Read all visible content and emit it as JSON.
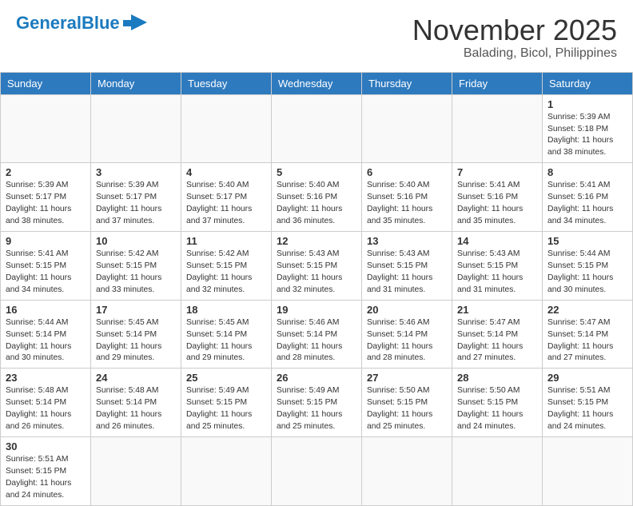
{
  "header": {
    "logo_general": "General",
    "logo_blue": "Blue",
    "month_title": "November 2025",
    "location": "Balading, Bicol, Philippines"
  },
  "weekdays": [
    "Sunday",
    "Monday",
    "Tuesday",
    "Wednesday",
    "Thursday",
    "Friday",
    "Saturday"
  ],
  "weeks": [
    [
      {
        "day": "",
        "text": ""
      },
      {
        "day": "",
        "text": ""
      },
      {
        "day": "",
        "text": ""
      },
      {
        "day": "",
        "text": ""
      },
      {
        "day": "",
        "text": ""
      },
      {
        "day": "",
        "text": ""
      },
      {
        "day": "1",
        "text": "Sunrise: 5:39 AM\nSunset: 5:18 PM\nDaylight: 11 hours\nand 38 minutes."
      }
    ],
    [
      {
        "day": "2",
        "text": "Sunrise: 5:39 AM\nSunset: 5:17 PM\nDaylight: 11 hours\nand 38 minutes."
      },
      {
        "day": "3",
        "text": "Sunrise: 5:39 AM\nSunset: 5:17 PM\nDaylight: 11 hours\nand 37 minutes."
      },
      {
        "day": "4",
        "text": "Sunrise: 5:40 AM\nSunset: 5:17 PM\nDaylight: 11 hours\nand 37 minutes."
      },
      {
        "day": "5",
        "text": "Sunrise: 5:40 AM\nSunset: 5:16 PM\nDaylight: 11 hours\nand 36 minutes."
      },
      {
        "day": "6",
        "text": "Sunrise: 5:40 AM\nSunset: 5:16 PM\nDaylight: 11 hours\nand 35 minutes."
      },
      {
        "day": "7",
        "text": "Sunrise: 5:41 AM\nSunset: 5:16 PM\nDaylight: 11 hours\nand 35 minutes."
      },
      {
        "day": "8",
        "text": "Sunrise: 5:41 AM\nSunset: 5:16 PM\nDaylight: 11 hours\nand 34 minutes."
      }
    ],
    [
      {
        "day": "9",
        "text": "Sunrise: 5:41 AM\nSunset: 5:15 PM\nDaylight: 11 hours\nand 34 minutes."
      },
      {
        "day": "10",
        "text": "Sunrise: 5:42 AM\nSunset: 5:15 PM\nDaylight: 11 hours\nand 33 minutes."
      },
      {
        "day": "11",
        "text": "Sunrise: 5:42 AM\nSunset: 5:15 PM\nDaylight: 11 hours\nand 32 minutes."
      },
      {
        "day": "12",
        "text": "Sunrise: 5:43 AM\nSunset: 5:15 PM\nDaylight: 11 hours\nand 32 minutes."
      },
      {
        "day": "13",
        "text": "Sunrise: 5:43 AM\nSunset: 5:15 PM\nDaylight: 11 hours\nand 31 minutes."
      },
      {
        "day": "14",
        "text": "Sunrise: 5:43 AM\nSunset: 5:15 PM\nDaylight: 11 hours\nand 31 minutes."
      },
      {
        "day": "15",
        "text": "Sunrise: 5:44 AM\nSunset: 5:15 PM\nDaylight: 11 hours\nand 30 minutes."
      }
    ],
    [
      {
        "day": "16",
        "text": "Sunrise: 5:44 AM\nSunset: 5:14 PM\nDaylight: 11 hours\nand 30 minutes."
      },
      {
        "day": "17",
        "text": "Sunrise: 5:45 AM\nSunset: 5:14 PM\nDaylight: 11 hours\nand 29 minutes."
      },
      {
        "day": "18",
        "text": "Sunrise: 5:45 AM\nSunset: 5:14 PM\nDaylight: 11 hours\nand 29 minutes."
      },
      {
        "day": "19",
        "text": "Sunrise: 5:46 AM\nSunset: 5:14 PM\nDaylight: 11 hours\nand 28 minutes."
      },
      {
        "day": "20",
        "text": "Sunrise: 5:46 AM\nSunset: 5:14 PM\nDaylight: 11 hours\nand 28 minutes."
      },
      {
        "day": "21",
        "text": "Sunrise: 5:47 AM\nSunset: 5:14 PM\nDaylight: 11 hours\nand 27 minutes."
      },
      {
        "day": "22",
        "text": "Sunrise: 5:47 AM\nSunset: 5:14 PM\nDaylight: 11 hours\nand 27 minutes."
      }
    ],
    [
      {
        "day": "23",
        "text": "Sunrise: 5:48 AM\nSunset: 5:14 PM\nDaylight: 11 hours\nand 26 minutes."
      },
      {
        "day": "24",
        "text": "Sunrise: 5:48 AM\nSunset: 5:14 PM\nDaylight: 11 hours\nand 26 minutes."
      },
      {
        "day": "25",
        "text": "Sunrise: 5:49 AM\nSunset: 5:15 PM\nDaylight: 11 hours\nand 25 minutes."
      },
      {
        "day": "26",
        "text": "Sunrise: 5:49 AM\nSunset: 5:15 PM\nDaylight: 11 hours\nand 25 minutes."
      },
      {
        "day": "27",
        "text": "Sunrise: 5:50 AM\nSunset: 5:15 PM\nDaylight: 11 hours\nand 25 minutes."
      },
      {
        "day": "28",
        "text": "Sunrise: 5:50 AM\nSunset: 5:15 PM\nDaylight: 11 hours\nand 24 minutes."
      },
      {
        "day": "29",
        "text": "Sunrise: 5:51 AM\nSunset: 5:15 PM\nDaylight: 11 hours\nand 24 minutes."
      }
    ],
    [
      {
        "day": "30",
        "text": "Sunrise: 5:51 AM\nSunset: 5:15 PM\nDaylight: 11 hours\nand 24 minutes."
      },
      {
        "day": "",
        "text": ""
      },
      {
        "day": "",
        "text": ""
      },
      {
        "day": "",
        "text": ""
      },
      {
        "day": "",
        "text": ""
      },
      {
        "day": "",
        "text": ""
      },
      {
        "day": "",
        "text": ""
      }
    ]
  ]
}
